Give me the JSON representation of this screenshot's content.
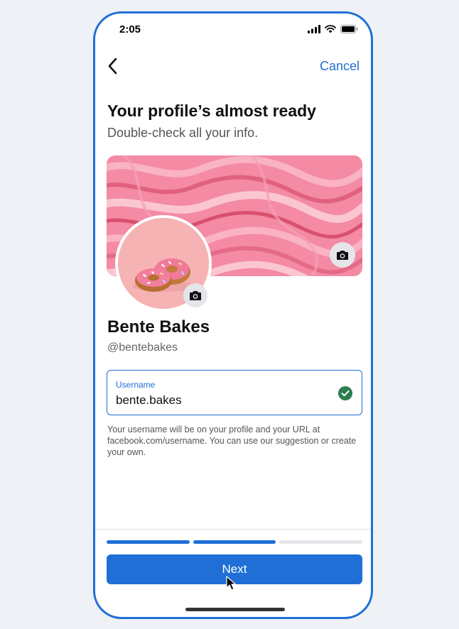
{
  "status_bar": {
    "time": "2:05",
    "icons": [
      "cellular-signal-icon",
      "wifi-icon",
      "battery-icon"
    ]
  },
  "nav": {
    "back_icon": "chevron-left-icon",
    "cancel_label": "Cancel"
  },
  "header": {
    "title": "Your profile’s almost ready",
    "subtitle": "Double-check all your info."
  },
  "profile": {
    "cover_photo": "pink-frosting-swirl",
    "avatar_photo": "pink-donuts",
    "cover_camera_icon": "camera-icon",
    "avatar_camera_icon": "camera-icon",
    "name": "Bente Bakes",
    "handle": "@bentebakes"
  },
  "username_field": {
    "label": "Username",
    "value": "bente.bakes",
    "status_icon": "check-circle-icon",
    "helper_text": "Your username will be on your profile and your URL at facebook.com/username. You can use our suggestion or create your own."
  },
  "progress": {
    "total_steps": 3,
    "completed_steps": 2
  },
  "footer": {
    "next_label": "Next"
  },
  "colors": {
    "accent": "#1f6fd6",
    "check_green": "#2e7d4f",
    "cover_pink": "#f48aa4",
    "avatar_bg": "#f6b3b3"
  }
}
